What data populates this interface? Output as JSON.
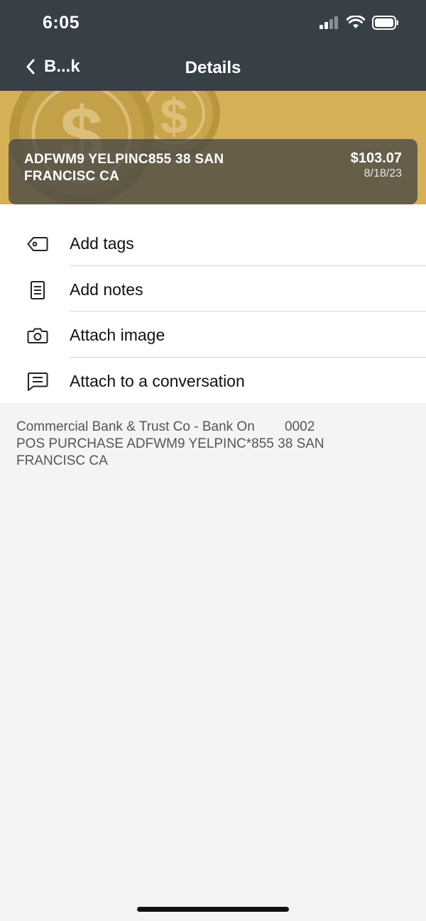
{
  "status_bar": {
    "time": "6:05",
    "icons": [
      "signal-icon",
      "wifi-icon",
      "battery-icon"
    ]
  },
  "nav": {
    "back_label": "B...k",
    "title": "Details"
  },
  "transaction": {
    "merchant": "ADFWM9 YELPINC855 38 SAN FRANCISC CA",
    "amount": "$103.07",
    "date": "8/18/23"
  },
  "actions": [
    {
      "label": "Add tags",
      "icon": "tag-icon"
    },
    {
      "label": "Add notes",
      "icon": "notes-icon"
    },
    {
      "label": "Attach image",
      "icon": "camera-icon"
    },
    {
      "label": "Attach to a conversation",
      "icon": "chat-icon"
    }
  ],
  "description": {
    "line1": "Commercial Bank & Trust Co - Bank On        0002",
    "line2": "POS PURCHASE ADFWM9 YELPINC*855 38 SAN",
    "line3": "FRANCISC CA"
  },
  "colors": {
    "header": "#373f47",
    "banner": "#d5b055",
    "card": "#464646"
  }
}
